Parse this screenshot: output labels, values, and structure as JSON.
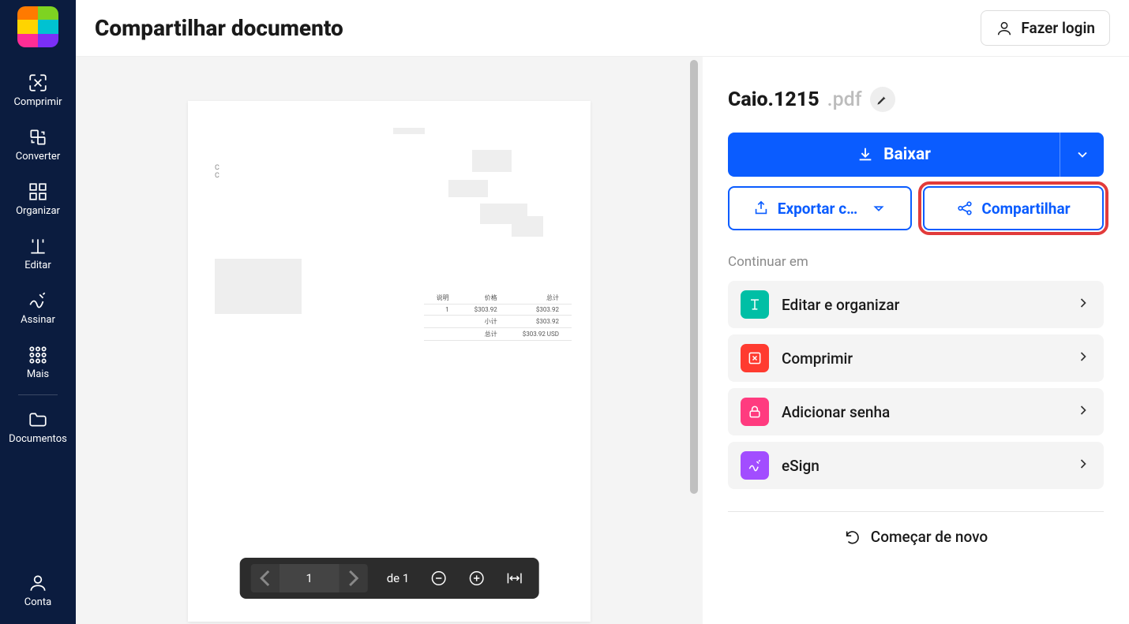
{
  "header": {
    "title": "Compartilhar documento",
    "login": "Fazer login"
  },
  "sidebar": {
    "items": [
      {
        "label": "Comprimir"
      },
      {
        "label": "Converter"
      },
      {
        "label": "Organizar"
      },
      {
        "label": "Editar"
      },
      {
        "label": "Assinar"
      },
      {
        "label": "Mais"
      }
    ],
    "documents": "Documentos",
    "account": "Conta"
  },
  "viewer": {
    "page_current": "1",
    "page_of_label": "de",
    "page_total": "1",
    "invoice": {
      "left_line1": "C",
      "left_line2": "C",
      "header": [
        "说明",
        "价格",
        "总计"
      ],
      "rows": [
        [
          "1",
          "$303.92",
          "$303.92"
        ],
        [
          "",
          "小计",
          "$303.92"
        ],
        [
          "",
          "总计",
          "$303.92 USD"
        ]
      ]
    }
  },
  "panel": {
    "filename": "Caio.1215",
    "ext": ".pdf",
    "download": "Baixar",
    "export": "Exportar c…",
    "share": "Compartilhar",
    "continue_label": "Continuar em",
    "continue_items": [
      {
        "label": "Editar e organizar",
        "color": "teal"
      },
      {
        "label": "Comprimir",
        "color": "red"
      },
      {
        "label": "Adicionar senha",
        "color": "pink"
      },
      {
        "label": "eSign",
        "color": "purple"
      }
    ],
    "restart": "Começar de novo"
  }
}
